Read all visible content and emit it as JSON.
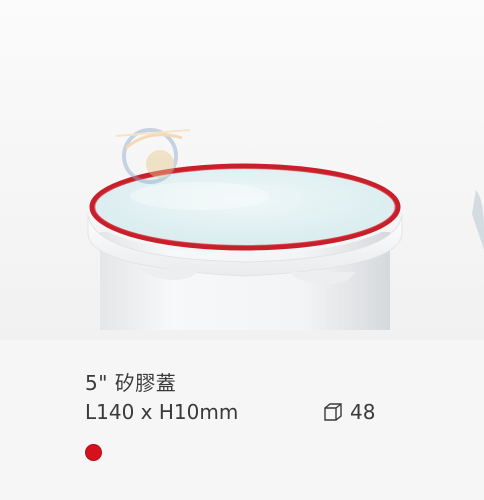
{
  "product": {
    "title": "5\" 矽膠蓋",
    "dimensions": "L140 x H10mm",
    "pack_quantity": "48",
    "pack_icon": "box-icon",
    "color_swatch": "#d4111c"
  },
  "colors": {
    "background": "#f6f6f6",
    "seal": "#c8202b",
    "text": "#3a3a3a"
  }
}
